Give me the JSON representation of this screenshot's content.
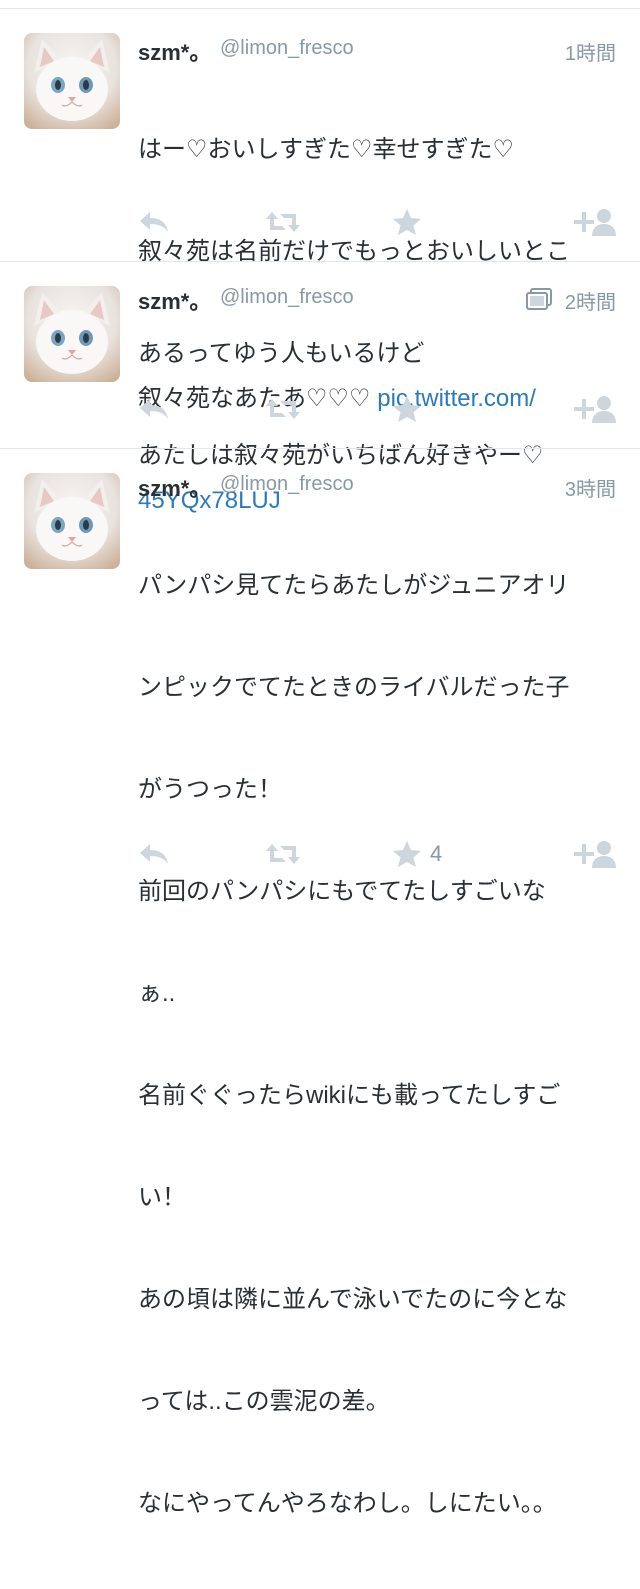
{
  "tweets": [
    {
      "name": "szm*。",
      "handle": "@limon_fresco",
      "time": "1時間",
      "lines": [
        "はー♡おいしすぎた♡幸せすぎた♡",
        "叙々苑は名前だけでもっとおいしいとこ",
        "あるってゆう人もいるけど",
        "あたしは叙々苑がいちばん好きやー♡"
      ],
      "has_media": false,
      "favorites": ""
    },
    {
      "name": "szm*。",
      "handle": "@limon_fresco",
      "time": "2時間",
      "text_prefix": "叙々苑なあたあ♡♡♡ ",
      "link_line1": "pic.twitter.com/",
      "link_line2": "45YQx78LUJ",
      "has_media": true,
      "favorites": ""
    },
    {
      "name": "szm*。",
      "handle": "@limon_fresco",
      "time": "3時間",
      "lines": [
        "パンパシ見てたらあたしがジュニアオリ",
        "ンピックでてたときのライバルだった子",
        "がうつった！",
        "前回のパンパシにもでてたしすごいな",
        "ぁ..",
        "名前ぐぐったらwikiにも載ってたしすご",
        "い！",
        "あの頃は隣に並んで泳いでたのに今とな",
        "っては..この雲泥の差。",
        "なにやってんやろなわし。しにたい。。"
      ],
      "has_media": false,
      "favorites": "4"
    }
  ],
  "icons": {
    "reply": "reply-icon",
    "retweet": "retweet-icon",
    "favorite": "star-icon",
    "follow": "follow-icon",
    "media": "media-icon"
  },
  "colors": {
    "text": "#292f33",
    "muted": "#8899a6",
    "icon": "#cdd6dd",
    "link": "#2b7bb9"
  }
}
